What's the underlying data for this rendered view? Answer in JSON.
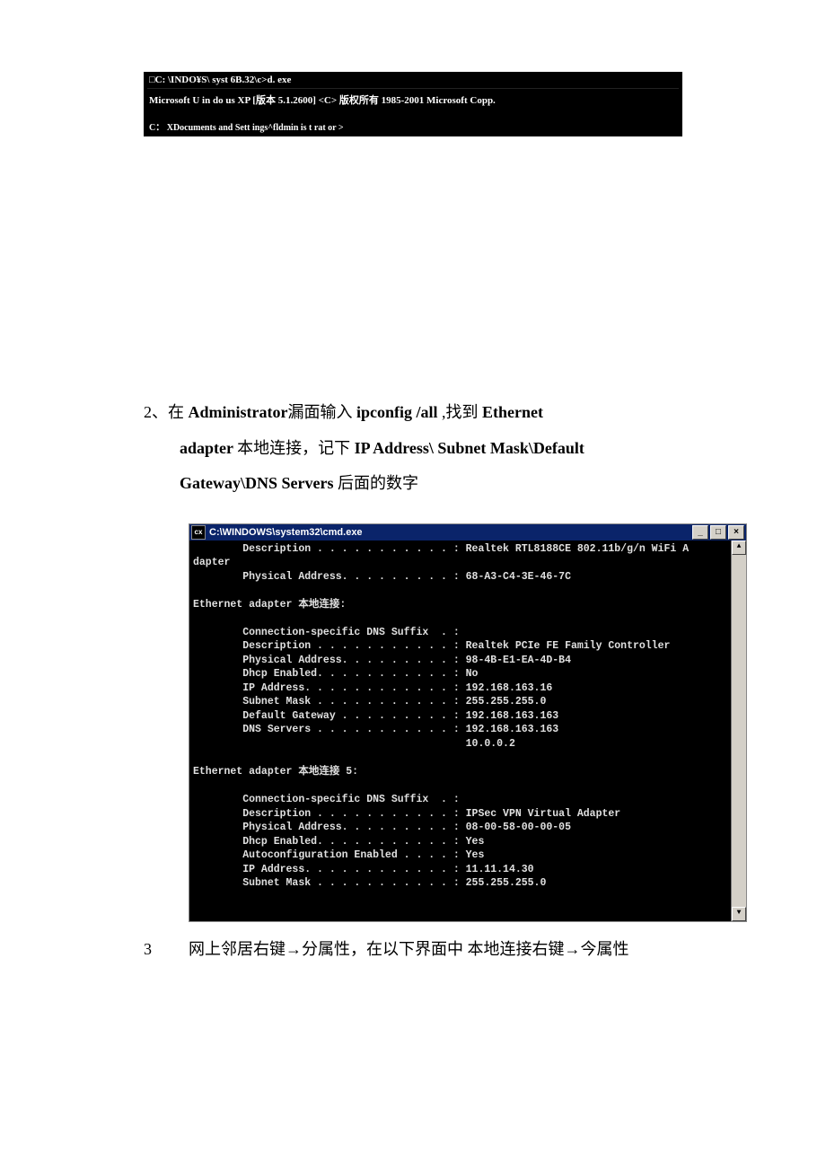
{
  "term1": {
    "title": "□C: \\⁠INDO¥S\\ syst 6B.32\\c>d. exe",
    "line1": "Microsoft U in do us XP [版本  5.1.2600] <C> 版权所有  1985-2001 Microsoft Copp.",
    "line2": "C： XDocuments and Sett ings^fldmin is t rat or >"
  },
  "step2": {
    "prefix": "2、在 ",
    "bold1": "Administrator",
    "mid1": "漏面输入 ",
    "bold2": "ipconfig /all",
    "mid2": "       ,找到  ",
    "bold3": "Ethernet",
    "line2_bold1": "adapter ",
    "line2_cn1": "本地连接，记下 ",
    "line2_bold2": "IP Address\\ Subnet Mask\\Default",
    "line3_bold": "Gateway\\DNS Servers ",
    "line3_cn": "后面的数字"
  },
  "cmd": {
    "title_prefix": "C:\\WINDOWS\\system32\\cmd.exe",
    "icon": "cx",
    "lines": [
      "        Description . . . . . . . . . . . : Realtek RTL8188CE 802.11b/g/n WiFi A",
      "dapter",
      "        Physical Address. . . . . . . . . : 68-A3-C4-3E-46-7C",
      "",
      "Ethernet adapter 本地连接:",
      "",
      "        Connection-specific DNS Suffix  . :",
      "        Description . . . . . . . . . . . : Realtek PCIe FE Family Controller",
      "        Physical Address. . . . . . . . . : 98-4B-E1-EA-4D-B4",
      "        Dhcp Enabled. . . . . . . . . . . : No",
      "        IP Address. . . . . . . . . . . . : 192.168.163.16",
      "        Subnet Mask . . . . . . . . . . . : 255.255.255.0",
      "        Default Gateway . . . . . . . . . : 192.168.163.163",
      "        DNS Servers . . . . . . . . . . . : 192.168.163.163",
      "                                            10.0.0.2",
      "",
      "Ethernet adapter 本地连接 5:",
      "",
      "        Connection-specific DNS Suffix  . :",
      "        Description . . . . . . . . . . . : IPSec VPN Virtual Adapter",
      "        Physical Address. . . . . . . . . : 08-00-58-00-00-05",
      "        Dhcp Enabled. . . . . . . . . . . : Yes",
      "        Autoconfiguration Enabled . . . . : Yes",
      "        IP Address. . . . . . . . . . . . : 11.11.14.30",
      "        Subnet Mask . . . . . . . . . . . : 255.255.255.0"
    ]
  },
  "step3": {
    "num": "3",
    "text": "网上邻居右键→分属性，在以下界面中 本地连接右键→今属性"
  },
  "winbuttons": {
    "min": "_",
    "max": "□",
    "close": "×",
    "up": "▲",
    "down": "▼"
  }
}
